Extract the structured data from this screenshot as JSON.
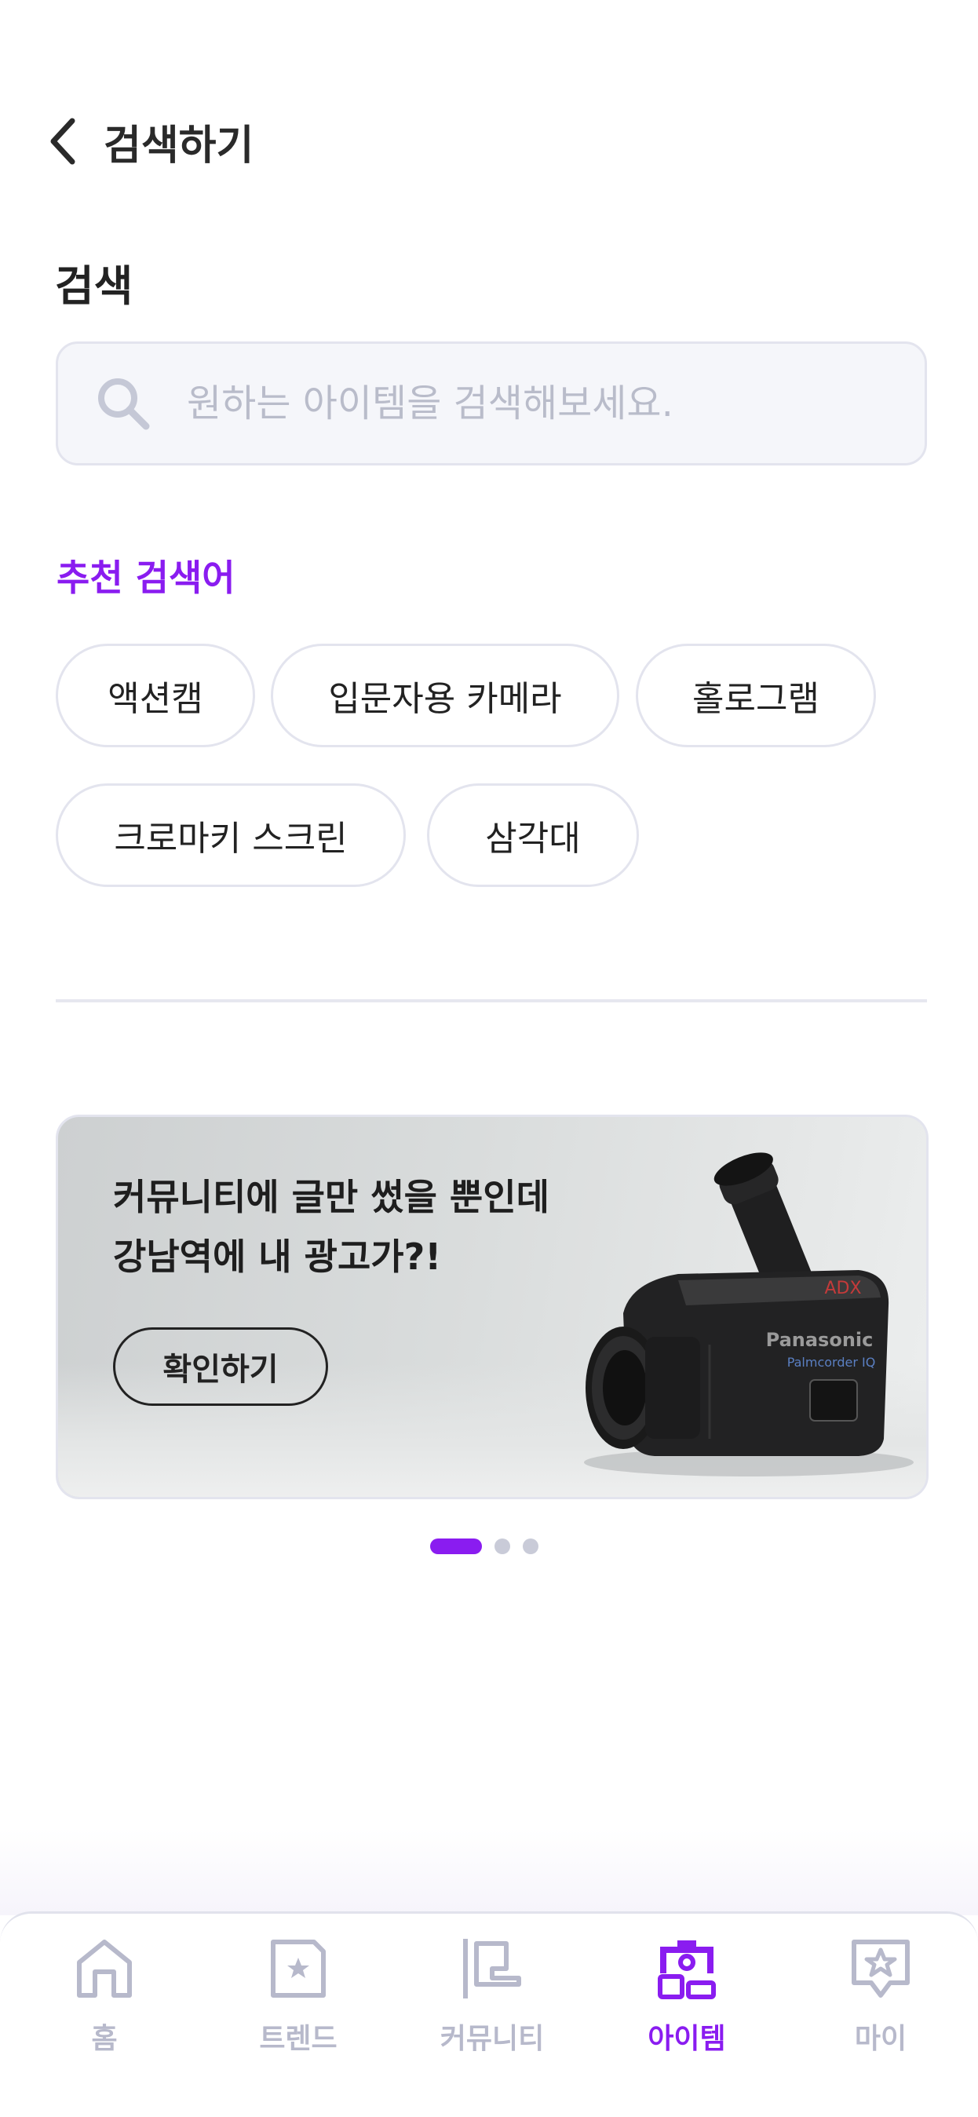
{
  "header": {
    "title": "검색하기"
  },
  "search": {
    "section_label": "검색",
    "placeholder": "원하는 아이템을 검색해보세요."
  },
  "recommended": {
    "label": "추천 검색어",
    "chips": [
      "액션캠",
      "입문자용 카메라",
      "홀로그램",
      "크로마키 스크린",
      "삼각대"
    ]
  },
  "banner": {
    "line1": "커뮤니티에 글만 썼을 뿐인데",
    "line2": "강남역에 내 광고가?!",
    "button_label": "확인하기",
    "camera_brand": "Panasonic",
    "camera_model": "Palmcorder IQ"
  },
  "pager": {
    "count": 3,
    "active_index": 0
  },
  "bottom_nav": {
    "items": [
      {
        "label": "홈",
        "icon": "home-icon"
      },
      {
        "label": "트렌드",
        "icon": "trend-icon"
      },
      {
        "label": "커뮤니티",
        "icon": "community-icon"
      },
      {
        "label": "아이템",
        "icon": "item-icon",
        "active": true
      },
      {
        "label": "마이",
        "icon": "my-icon"
      }
    ]
  },
  "colors": {
    "accent": "#8a1cf0",
    "inactive": "#b7b9cb",
    "chip_border": "#e3e4ee",
    "search_bg": "#f5f6fa"
  }
}
